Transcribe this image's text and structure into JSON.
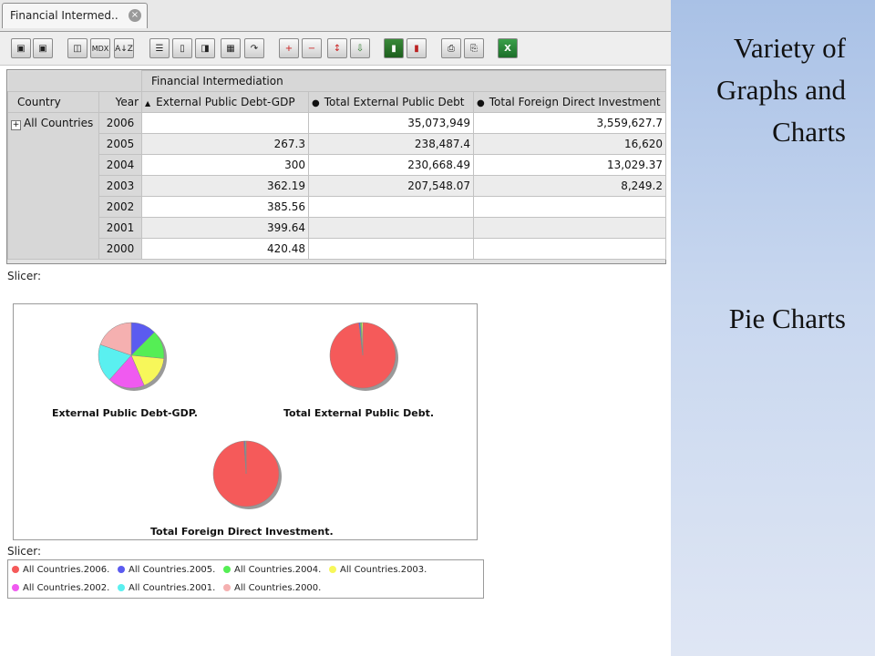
{
  "tab": {
    "title": "Financial Intermed..",
    "close_icon": "close-icon"
  },
  "toolbar": {
    "mdx_label": "MDX",
    "sort_label": "A↓Z"
  },
  "pivot": {
    "group_header": "Financial Intermediation",
    "columns": [
      "Country",
      "Year",
      "External Public Debt-GDP",
      "Total External Public Debt",
      "Total Foreign Direct Investment"
    ],
    "row_label": "All Countries",
    "rows": [
      {
        "year": "2006",
        "debt_gdp": "",
        "total_debt": "35,073,949",
        "fdi": "3,559,627.7"
      },
      {
        "year": "2005",
        "debt_gdp": "267.3",
        "total_debt": "238,487.4",
        "fdi": "16,620"
      },
      {
        "year": "2004",
        "debt_gdp": "300",
        "total_debt": "230,668.49",
        "fdi": "13,029.37"
      },
      {
        "year": "2003",
        "debt_gdp": "362.19",
        "total_debt": "207,548.07",
        "fdi": "8,249.2"
      },
      {
        "year": "2002",
        "debt_gdp": "385.56",
        "total_debt": "",
        "fdi": ""
      },
      {
        "year": "2001",
        "debt_gdp": "399.64",
        "total_debt": "",
        "fdi": ""
      },
      {
        "year": "2000",
        "debt_gdp": "420.48",
        "total_debt": "",
        "fdi": ""
      }
    ]
  },
  "slicer_top": "Slicer:",
  "slicer_bottom": "Slicer:",
  "chart_data": [
    {
      "type": "pie",
      "title": "External Public Debt-GDP.",
      "labels": [
        "All Countries.2005.",
        "All Countries.2004.",
        "All Countries.2003.",
        "All Countries.2002.",
        "All Countries.2001.",
        "All Countries.2000."
      ],
      "values": [
        267.3,
        300,
        362.19,
        385.56,
        399.64,
        420.48
      ],
      "colors": [
        "#5b5bf0",
        "#55ee55",
        "#f7f75a",
        "#f05af0",
        "#5af0f0",
        "#f5b0b0"
      ]
    },
    {
      "type": "pie",
      "title": "Total External Public Debt.",
      "labels": [
        "All Countries.2006.",
        "All Countries.2005.",
        "All Countries.2004.",
        "All Countries.2003."
      ],
      "values": [
        35073949,
        238487.4,
        230668.49,
        207548.07
      ],
      "colors": [
        "#f55a5a",
        "#5b5bf0",
        "#55ee55",
        "#f7f75a"
      ]
    },
    {
      "type": "pie",
      "title": "Total Foreign Direct Investment.",
      "labels": [
        "All Countries.2006.",
        "All Countries.2005.",
        "All Countries.2004.",
        "All Countries.2003."
      ],
      "values": [
        3559627.7,
        16620,
        13029.37,
        8249.2
      ],
      "colors": [
        "#f55a5a",
        "#5b5bf0",
        "#55ee55",
        "#f7f75a"
      ]
    }
  ],
  "legend": [
    {
      "label": "All Countries.2006.",
      "color": "#f55a5a"
    },
    {
      "label": "All Countries.2005.",
      "color": "#5b5bf0"
    },
    {
      "label": "All Countries.2004.",
      "color": "#55ee55"
    },
    {
      "label": "All Countries.2003.",
      "color": "#f7f75a"
    },
    {
      "label": "All Countries.2002.",
      "color": "#f05af0"
    },
    {
      "label": "All Countries.2001.",
      "color": "#5af0f0"
    },
    {
      "label": "All Countries.2000.",
      "color": "#f5b0b0"
    }
  ],
  "panel": {
    "lines": [
      "Variety of",
      "Graphs and",
      "Charts"
    ],
    "subtitle": "Pie Charts"
  }
}
